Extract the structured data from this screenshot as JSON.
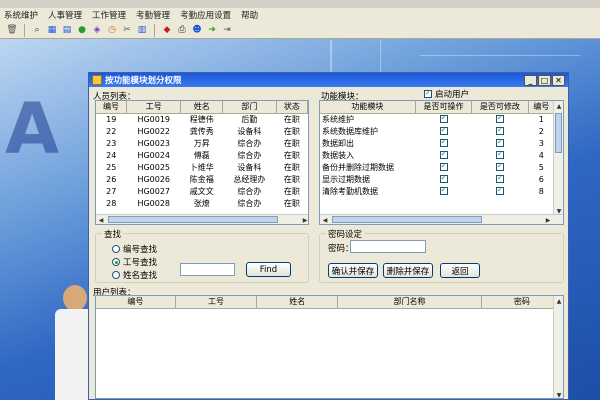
{
  "menu": {
    "items": [
      "系统维护",
      "人事管理",
      "工作管理",
      "考勤管理",
      "考勤应用设置",
      "帮助"
    ]
  },
  "toolbar": {
    "icons": [
      "delete-icon",
      "binoculars-icon",
      "grid-icon",
      "table-icon",
      "green-circle-icon",
      "group-icon",
      "clock-icon",
      "tools-icon",
      "chart-icon",
      "shield-icon",
      "printer-icon",
      "people-icon",
      "arrow-icon",
      "exit-icon"
    ]
  },
  "dialog": {
    "title": "按功能模块划分权限",
    "personnel_label": "人员列表：",
    "module_label": "功能模块：",
    "enable_user_label": "启动用户",
    "enable_user_checked": true
  },
  "personnel": {
    "columns": [
      "编号",
      "工号",
      "姓名",
      "部门",
      "状态"
    ],
    "rows": [
      [
        "19",
        "HG0019",
        "程德伟",
        "后勤",
        "在职"
      ],
      [
        "22",
        "HG0022",
        "龚传秀",
        "设备科",
        "在职"
      ],
      [
        "23",
        "HG0023",
        "万昇",
        "综合办",
        "在职"
      ],
      [
        "24",
        "HG0024",
        "傅磊",
        "综合办",
        "在职"
      ],
      [
        "25",
        "HG0025",
        "卜维华",
        "设备科",
        "在职"
      ],
      [
        "26",
        "HG0026",
        "陈金福",
        "总经理办",
        "在职"
      ],
      [
        "27",
        "HG0027",
        "戚文文",
        "综合办",
        "在职"
      ],
      [
        "28",
        "HG0028",
        "张燎",
        "综合办",
        "在职"
      ]
    ]
  },
  "modules": {
    "columns": [
      "功能模块",
      "是否可操作",
      "是否可修改",
      "编号"
    ],
    "rows": [
      {
        "name": "系统维护",
        "op": true,
        "mod": true,
        "id": "1"
      },
      {
        "name": "系统数据库维护",
        "op": true,
        "mod": true,
        "id": "2"
      },
      {
        "name": "数据卸出",
        "op": true,
        "mod": true,
        "id": "3"
      },
      {
        "name": "数据装入",
        "op": true,
        "mod": true,
        "id": "4"
      },
      {
        "name": "备份并删除过期数据",
        "op": true,
        "mod": true,
        "id": "5"
      },
      {
        "name": "显示过期数据",
        "op": true,
        "mod": true,
        "id": "6"
      },
      {
        "name": "清除考勤机数据",
        "op": true,
        "mod": true,
        "id": "8"
      }
    ]
  },
  "search": {
    "group_title": "查找",
    "options": [
      "编号查找",
      "工号查找",
      "姓名查找"
    ],
    "selected": 1,
    "input_value": "",
    "find_label": "Find"
  },
  "password": {
    "group_title": "密码设定",
    "label": "密码：",
    "value": "",
    "confirm_save": "确认并保存",
    "delete_save": "删除并保存",
    "back": "返回"
  },
  "users": {
    "label": "用户列表：",
    "columns": [
      "编号",
      "工号",
      "姓名",
      "部门名称",
      "密码"
    ]
  }
}
